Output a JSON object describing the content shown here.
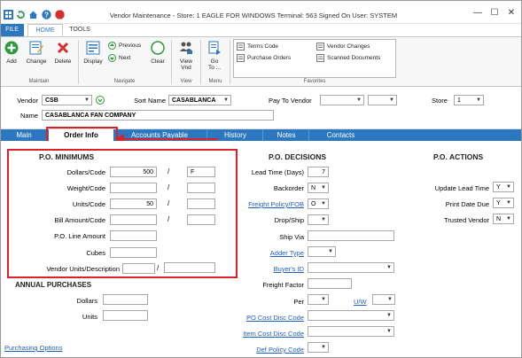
{
  "window": {
    "title": "Vendor Maintenance - Store: 1 EAGLE FOR WINDOWS Terminal: 563 Signed On User: SYSTEM",
    "minimize": "—",
    "maximize": "☐",
    "close": "✕"
  },
  "ribbon_tabs": {
    "file": "FILE",
    "home": "HOME",
    "tools": "TOOLS"
  },
  "ribbon": {
    "maintain": {
      "add": "Add",
      "change": "Change",
      "delete": "Delete",
      "group": "Maintain"
    },
    "navigate": {
      "display": "Display",
      "previous": "Previous",
      "next": "Next",
      "clear": "Clear",
      "group": "Navigate"
    },
    "view": {
      "view_vnd_line1": "View",
      "view_vnd_line2": "Vnd",
      "group": "View"
    },
    "menu": {
      "goto_line1": "Go",
      "goto_line2": "To ...",
      "group": "Menu"
    },
    "favorites": {
      "terms_code": "Terms Code",
      "vendor_changes": "Vendor Changes",
      "purchase_orders": "Purchase Orders",
      "scanned_documents": "Scanned Documents",
      "group": "Favorites"
    }
  },
  "header": {
    "vendor_label": "Vendor",
    "vendor_value": "CSB",
    "sort_name_label": "Sort Name",
    "sort_name_value": "CASABLANCA",
    "pay_to_vendor_label": "Pay To Vendor",
    "pay_to_vendor_value": "",
    "pay_to_vendor_value2": "",
    "store_label": "Store",
    "store_value": "1",
    "name_label": "Name",
    "name_value": "CASABLANCA FAN COMPANY"
  },
  "tabs": {
    "main": "Main",
    "order_info": "Order Info",
    "accounts_payable": "Accounts Payable",
    "history": "History",
    "notes": "Notes",
    "contacts": "Contacts"
  },
  "po_minimums": {
    "title": "P.O. MINIMUMS",
    "dollars_code_label": "Dollars/Code",
    "dollars_value": "500",
    "dollars_code": "F",
    "weight_code_label": "Weight/Code",
    "units_code_label": "Units/Code",
    "units_value": "50",
    "bill_amount_code_label": "Bill Amount/Code",
    "po_line_amount_label": "P.O. Line Amount",
    "cubes_label": "Cubes",
    "vendor_units_desc_label": "Vendor Units/Description",
    "slash": "/"
  },
  "annual_purchases": {
    "title": "ANNUAL PURCHASES",
    "dollars_label": "Dollars",
    "units_label": "Units"
  },
  "po_decisions": {
    "title": "P.O. DECISIONS",
    "lead_time_label": "Lead Time (Days)",
    "lead_time_value": "7",
    "backorder_label": "Backorder",
    "backorder_value": "N",
    "freight_policy_label": "Freight Policy/FOB",
    "freight_policy_value": "O",
    "drop_ship_label": "Drop/Ship",
    "ship_via_label": "Ship Via",
    "adder_type_label": "Adder Type",
    "buyers_id_label": "Buyer's ID",
    "freight_factor_label": "Freight Factor",
    "per_label": "Per",
    "uw_label": "U/W",
    "po_cost_disc_code_label": "PO Cost Disc Code",
    "item_cost_disc_code_label": "Item Cost Disc Code",
    "def_policy_code_label": "Def Policy Code"
  },
  "po_actions": {
    "title": "P.O. ACTIONS",
    "update_lead_time_label": "Update Lead Time",
    "update_lead_time_value": "Y",
    "print_date_due_label": "Print Date Due",
    "print_date_due_value": "Y",
    "trusted_vendor_label": "Trusted Vendor",
    "trusted_vendor_value": "N"
  },
  "links": {
    "purchasing_options": "Purchasing Options"
  },
  "colors": {
    "accent": "#2b78c0",
    "highlight_red": "#d9222a"
  }
}
